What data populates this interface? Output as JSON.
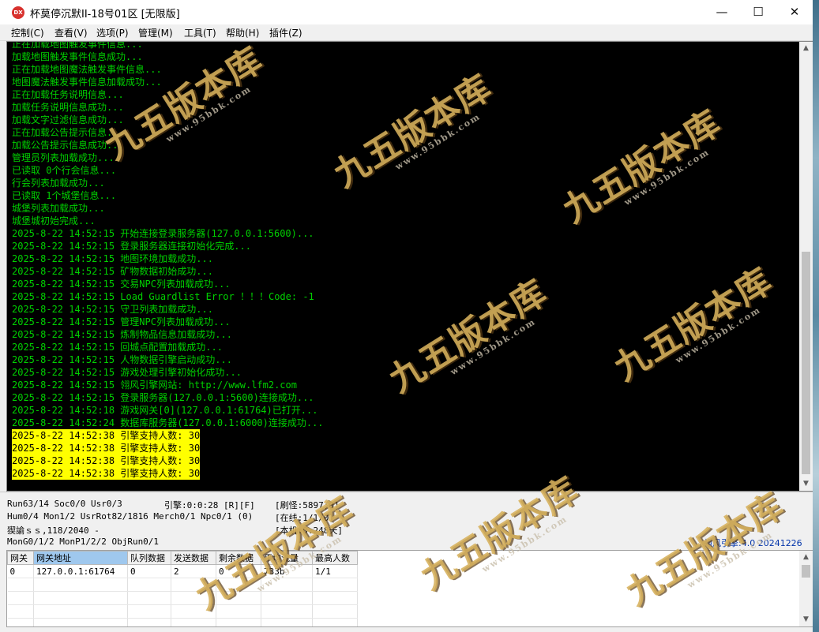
{
  "window": {
    "title": "杯莫停沉默II-18号01区 [无限版]",
    "app_icon_text": "DX",
    "minimize_glyph": "—",
    "maximize_glyph": "☐",
    "close_glyph": "✕"
  },
  "menu": {
    "items": [
      {
        "label": "控制(C)"
      },
      {
        "label": "查看(V)"
      },
      {
        "label": "选项(P)"
      },
      {
        "label": "管理(M)"
      },
      {
        "label": "工具(T)"
      },
      {
        "label": "帮助(H)"
      },
      {
        "label": "插件(Z)"
      }
    ]
  },
  "log": {
    "lines": [
      "正在加载地图触发事件信息...",
      "加载地图触发事件信息成功...",
      "正在加载地图魔法触发事件信息...",
      "地图魔法触发事件信息加载成功...",
      "正在加载任务说明信息...",
      "加载任务说明信息成功...",
      "加载文字过滤信息成功...",
      "正在加载公告提示信息...",
      "加载公告提示信息成功...",
      "管理员列表加载成功...",
      "已读取 0个行会信息...",
      "行会列表加载成功...",
      "已读取 1个城堡信息...",
      "城堡列表加载成功...",
      "城堡城初始完成...",
      "2025-8-22 14:52:15 开始连接登录服务器(127.0.0.1:5600)...",
      "2025-8-22 14:52:15 登录服务器连接初始化完成...",
      "2025-8-22 14:52:15 地图环境加载成功...",
      "2025-8-22 14:52:15 矿物数据初始成功...",
      "2025-8-22 14:52:15 交易NPC列表加载成功...",
      "2025-8-22 14:52:15 Load Guardlist Error ！！！Code: -1",
      "2025-8-22 14:52:15 守卫列表加载成功...",
      "2025-8-22 14:52:15 管理NPC列表加载成功...",
      "2025-8-22 14:52:15 炼制物品信息加载成功...",
      "2025-8-22 14:52:15 回城点配置加载成功...",
      "2025-8-22 14:52:15 人物数据引擎启动成功...",
      "2025-8-22 14:52:15 游戏处理引擎初始化成功...",
      "2025-8-22 14:52:15 翎风引擎网站: http://www.lfm2.com",
      "2025-8-22 14:52:15 登录服务器(127.0.0.1:5600)连接成功...",
      "2025-8-22 14:52:18 游戏网关[0](127.0.0.1:61764)已打开...",
      "2025-8-22 14:52:24 数据库服务器(127.0.0.1:6000)连接成功..."
    ],
    "highlighted_lines": [
      "2025-8-22 14:52:38 引擎支持人数: 30",
      "2025-8-22 14:52:38 引擎支持人数: 30",
      "2025-8-22 14:52:38 引擎支持人数: 30",
      "2025-8-22 14:52:38 引擎支持人数: 30"
    ],
    "scroll_up_glyph": "▲",
    "scroll_down_glyph": "▼"
  },
  "status": {
    "run": "Run63/14 Soc0/0 Usr0/3",
    "engine": "引擎:0:0:28 [R][F]",
    "refresh": "[刷怪:5897;0]",
    "hum": "Hum0/4 Mon1/2 UsrRot82/1816 Merch0/1 Npc0/1 (0)",
    "online": "[在线:1/1/0]",
    "misc": "猰諭ｓｓ,118/2040 -",
    "local": "[本机:0.248天]",
    "mongo": "MonG0/1/2 MonP1/2/2 ObjRun0/1",
    "version": "翎风引擎:4.0 20241226"
  },
  "gateway_table": {
    "headers": [
      "网关",
      "网关地址",
      "队列数据",
      "发送数据",
      "剩余数据",
      "平均流量",
      "最高人数"
    ],
    "rows": [
      [
        "0",
        "127.0.0.1:61764",
        "0",
        "2",
        "0",
        "733b",
        "1/1"
      ]
    ],
    "scroll_up_glyph": "▲",
    "scroll_down_glyph": "▼"
  },
  "watermark": {
    "main": "九五版本库",
    "sub": "www.95bbk.com"
  }
}
